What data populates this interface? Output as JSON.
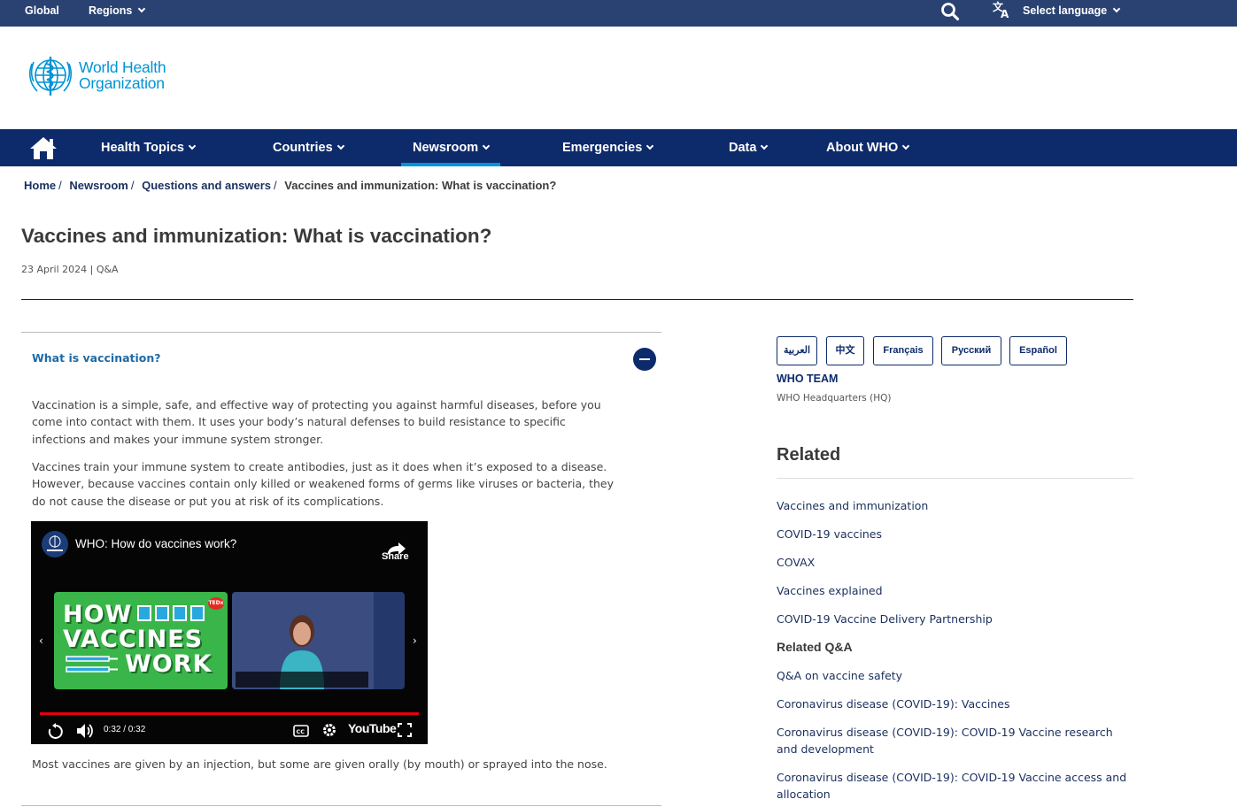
{
  "topbar": {
    "global": "Global",
    "regions": "Regions",
    "select_language": "Select language",
    "search_icon": "search-icon",
    "language_icon": "translate-icon"
  },
  "logo": {
    "line1": "World Health",
    "line2": "Organization"
  },
  "nav": {
    "items": [
      {
        "label": "Health Topics"
      },
      {
        "label": "Countries"
      },
      {
        "label": "Newsroom",
        "active": true
      },
      {
        "label": "Emergencies"
      },
      {
        "label": "Data"
      },
      {
        "label": "About WHO"
      }
    ]
  },
  "breadcrumb": {
    "items": [
      "Home",
      "Newsroom",
      "Questions and answers"
    ],
    "current": "Vaccines and immunization: What is vaccination?"
  },
  "article": {
    "title": "Vaccines and immunization: What is vaccination?",
    "meta": "23 April 2024 | Q&A"
  },
  "accordion": {
    "title": "What is vaccination?",
    "paragraphs": [
      "Vaccination is a simple, safe, and effective way of protecting you against harmful diseases, before you come into contact with them. It uses your body’s natural defenses to build resistance to specific infections and makes your immune system stronger.",
      "Vaccines train your immune system to create antibodies, just as it does when it’s exposed to a disease. However, because vaccines contain only killed or weakened forms of germs like viruses or bacteria, they do not cause the disease or put you at risk of its complications.",
      "Most vaccines are given by an injection, but some are given orally (by mouth) or sprayed into the nose."
    ]
  },
  "video": {
    "title": "WHO: How do vaccines work?",
    "share": "Share",
    "time": "0:32 / 0:32",
    "youtube": "YouTube",
    "thumb_lines": [
      "HOW",
      "VACCINES",
      "WORK"
    ],
    "ted_badge": "TEDx",
    "progress": 1.0,
    "colors": {
      "progress": "#e3000f",
      "thumb1": "#3ab54a"
    }
  },
  "sidebar": {
    "languages": [
      "العربية",
      "中文",
      "Français",
      "Русский",
      "Español"
    ],
    "team": "WHO TEAM",
    "team_sub": "WHO Headquarters (HQ)",
    "related_heading": "Related",
    "related_links": [
      "Vaccines and immunization",
      "COVID-19 vaccines",
      "COVAX",
      "Vaccines explained",
      "COVID-19 Vaccine Delivery Partnership"
    ],
    "related_qa_heading": "Related Q&A",
    "related_qa_links": [
      "Q&A on vaccine safety",
      "Coronavirus disease (COVID-19): Vaccines",
      "Coronavirus disease (COVID-19): COVID-19 Vaccine research and development",
      "Coronavirus disease (COVID-19): COVID-19 Vaccine access and allocation"
    ]
  },
  "colors": {
    "topbar": "#2a4272",
    "nav": "#0d2a6b",
    "accent": "#0093d5",
    "link": "#1a2f5e"
  }
}
